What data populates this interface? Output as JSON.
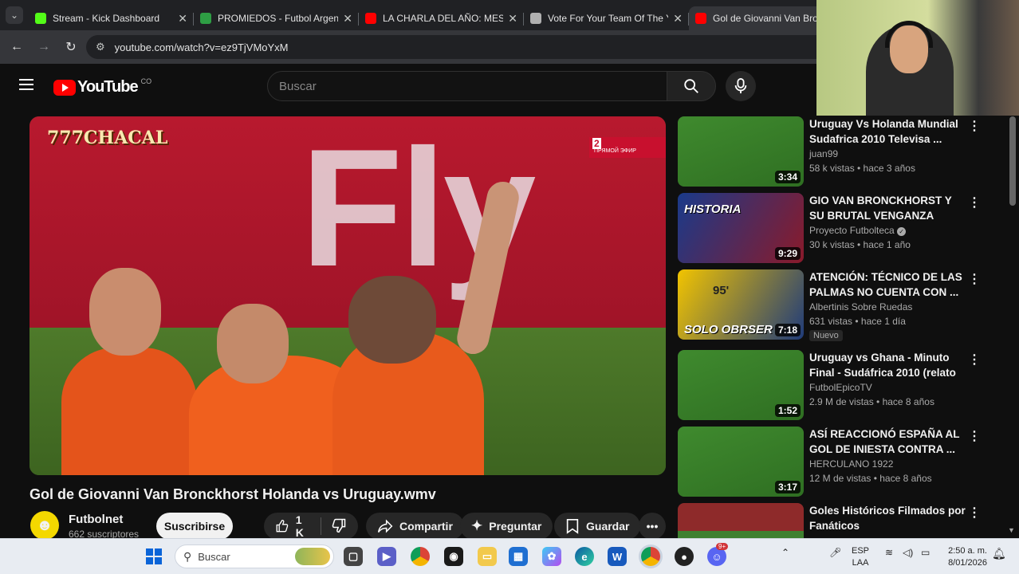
{
  "browser": {
    "tabs": [
      {
        "title": "Stream - Kick Dashboard",
        "icon": "kick-icon",
        "color": "#53fc18",
        "active": false
      },
      {
        "title": "PROMIEDOS - Futbol Argentino",
        "icon": "promiedos-icon",
        "color": "#2e9e44",
        "active": false
      },
      {
        "title": "LA CHARLA DEL AÑO: MESSI",
        "icon": "youtube-icon",
        "color": "#ff0000",
        "active": false
      },
      {
        "title": "Vote For Your Team Of The Year",
        "icon": "ea-icon",
        "color": "#b0b0b0",
        "active": false
      },
      {
        "title": "Gol de Giovanni Van Bronckhorst",
        "icon": "youtube-icon",
        "color": "#ff0000",
        "active": true
      }
    ],
    "close_glyph": "✕",
    "url": "youtube.com/watch?v=ez9TjVMoYxM"
  },
  "youtube": {
    "logo_text": "YouTube",
    "country": "CO",
    "search_placeholder": "Buscar",
    "video": {
      "title": "Gol de Giovanni Van Bronckhorst Holanda vs Uruguay.wmv",
      "watermark": "777CHACAL",
      "broadcast_channel": "2",
      "broadcast_tag": "ПРЯМОЙ ЭФИР",
      "ad_board_text": "Fly Em"
    },
    "channel": {
      "name": "Futbolnet",
      "subscribers": "662 suscriptores",
      "subscribe_label": "Suscribirse"
    },
    "actions": {
      "likes": "1 K",
      "share": "Compartir",
      "ask": "Preguntar",
      "save": "Guardar"
    },
    "recommendations": [
      {
        "title": "Uruguay Vs Holanda Mundial Sudafrica 2010 Televisa ...",
        "channel": "juan99",
        "meta": "58 k vistas • hace 3 años",
        "duration": "3:34",
        "thumb": "t-field",
        "badge": ""
      },
      {
        "title": "GIO VAN BRONCKHORST Y SU BRUTAL VENGANZA CONTRA ...",
        "channel": "Proyecto Futbolteca",
        "verified": true,
        "meta": "30 k vistas • hace 1 año",
        "duration": "9:29",
        "thumb": "t-red",
        "thumb_text": "HISTORIA",
        "badge": ""
      },
      {
        "title": "ATENCIÓN: TÉCNICO DE LAS PALMAS NO CUENTA CON ...",
        "channel": "Albertinis Sobre Ruedas",
        "meta": "631 vistas • hace 1 día",
        "duration": "7:18",
        "thumb": "t-yel",
        "thumb_text": "SOLO OBRSER",
        "thumb_num": "95'",
        "badge": "Nuevo"
      },
      {
        "title": "Uruguay vs Ghana - Minuto Final - Sudáfrica 2010 (relato ...",
        "channel": "FutbolEpicoTV",
        "meta": "2.9 M de vistas • hace 8 años",
        "duration": "1:52",
        "thumb": "t-field",
        "badge": ""
      },
      {
        "title": "ASÍ REACCIONÓ ESPAÑA  AL GOL DE INIESTA CONTRA ...",
        "channel": "HERCULANO 1922",
        "meta": "12 M de vistas • hace 8 años",
        "duration": "3:17",
        "thumb": "t-field",
        "badge": ""
      },
      {
        "title": "Goles Históricos Filmados por Fanáticos",
        "channel": "",
        "meta": "",
        "duration": "",
        "thumb": "t-stad",
        "badge": ""
      }
    ]
  },
  "taskbar": {
    "search_placeholder": "Buscar",
    "lang_top": "ESP",
    "lang_bottom": "LAA",
    "time": "2:50 a. m.",
    "date": "8/01/2026",
    "badge": "9+"
  }
}
